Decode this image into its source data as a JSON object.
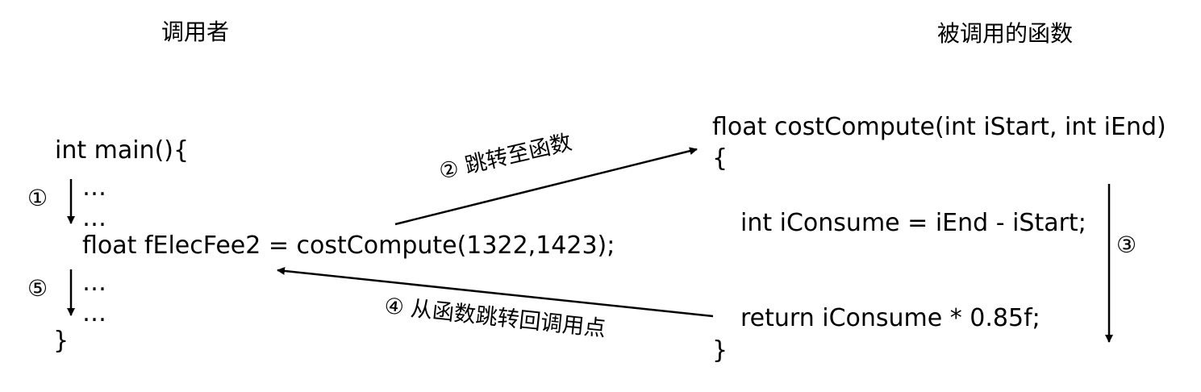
{
  "headers": {
    "caller": "调用者",
    "callee": "被调用的函数"
  },
  "caller_code": {
    "line1": "int main(){",
    "line2": "…",
    "line3": "…",
    "line4": "float fElecFee2 = costCompute(1322,1423);",
    "line5": "…",
    "line6": "…",
    "line7": "}"
  },
  "callee_code": {
    "signature": "float costCompute(int iStart, int iEnd)",
    "open_brace": "{",
    "statement1": "int iConsume = iEnd - iStart;",
    "statement2": "return iConsume * 0.85f;",
    "close_brace": "}"
  },
  "steps": {
    "step1": "①",
    "step2": "② 跳转至函数",
    "step3": "③",
    "step4": "④ 从函数跳转回调用点",
    "step5": "⑤"
  },
  "colors": {
    "text": "#000000",
    "arrow": "#000000",
    "background": "#ffffff"
  }
}
